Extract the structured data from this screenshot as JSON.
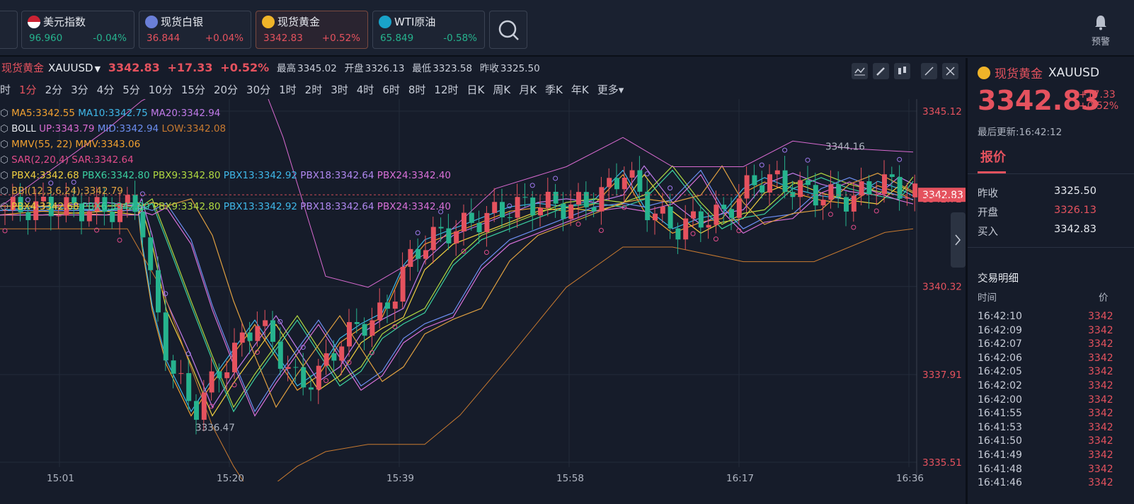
{
  "tickers": [
    {
      "name": "美元指数",
      "price": "96.960",
      "change": "-0.04%",
      "dir": "down",
      "icon": "us-flag-icon"
    },
    {
      "name": "现货白银",
      "price": "36.844",
      "change": "+0.04%",
      "dir": "up",
      "icon": "silver-icon"
    },
    {
      "name": "现货黄金",
      "price": "3342.83",
      "change": "+0.52%",
      "dir": "up",
      "icon": "gold-icon"
    },
    {
      "name": "WTI原油",
      "price": "65.849",
      "change": "-0.58%",
      "dir": "down",
      "icon": "oil-icon"
    }
  ],
  "alert_label": "预警",
  "header": {
    "name": "现货黄金",
    "symbol": "XAUUSD",
    "price": "3342.83",
    "change": "+17.33",
    "pct": "+0.52%",
    "high_label": "最高",
    "high": "3345.02",
    "open_label": "开盘",
    "open": "3326.13",
    "low_label": "最低",
    "low": "3323.58",
    "prev_label": "昨收",
    "prev": "3325.50"
  },
  "periods": [
    "时",
    "1分",
    "2分",
    "3分",
    "4分",
    "5分",
    "10分",
    "15分",
    "20分",
    "30分",
    "1时",
    "2时",
    "3时",
    "4时",
    "6时",
    "8时",
    "12时",
    "日K",
    "周K",
    "月K",
    "季K",
    "年K",
    "更多"
  ],
  "selected_period": "1分",
  "indicators": {
    "ma": [
      {
        "t": "MA5:3342.55",
        "c": "#f0a030"
      },
      {
        "t": "MA10:3342.75",
        "c": "#3fb7e8"
      },
      {
        "t": "MA20:3342.94",
        "c": "#c07ae8"
      }
    ],
    "boll": [
      {
        "t": "BOLL",
        "c": "#e5e8ee"
      },
      {
        "t": "UP:3343.79",
        "c": "#d86ad0"
      },
      {
        "t": "MID:3342.94",
        "c": "#6c8ef0"
      },
      {
        "t": "LOW:3342.08",
        "c": "#c87a30"
      }
    ],
    "mmv": [
      {
        "t": "MMV(55, 22)",
        "c": "#f0a030"
      },
      {
        "t": "MMV:3343.06",
        "c": "#f0a030"
      }
    ],
    "sar": [
      {
        "t": "SAR(2,20,4)",
        "c": "#e04c8a"
      },
      {
        "t": "SAR:3342.64",
        "c": "#e04c8a"
      }
    ],
    "pbx": [
      {
        "t": "PBX4:3342.68",
        "c": "#f0d040"
      },
      {
        "t": "PBX6:3342.80",
        "c": "#3bd0a0"
      },
      {
        "t": "PBX9:3342.80",
        "c": "#b0d840"
      },
      {
        "t": "PBX13:3342.92",
        "c": "#3fb7e8"
      },
      {
        "t": "PBX18:3342.64",
        "c": "#b088f0"
      },
      {
        "t": "PBX24:3342.40",
        "c": "#d870d8"
      }
    ],
    "bbi": [
      {
        "t": "BBI(12,3,6,24):3342.79",
        "c": "#e0a040"
      }
    ],
    "pbx2": [
      {
        "t": "PBX4:3342.68",
        "c": "#f0d040"
      },
      {
        "t": "PBX6:3342.80",
        "c": "#3bd0a0"
      },
      {
        "t": "PBX9:3342.80",
        "c": "#b0d840"
      },
      {
        "t": "PBX13:3342.92",
        "c": "#3fb7e8"
      },
      {
        "t": "PBX18:3342.64",
        "c": "#b088f0"
      },
      {
        "t": "PBX24:3342.40",
        "c": "#d870d8"
      }
    ]
  },
  "y_ticks": [
    "3345.12",
    "3342.72",
    "3340.32",
    "3337.91",
    "3335.51"
  ],
  "current_price_tag": "3342.83",
  "x_ticks": [
    "15:01",
    "15:20",
    "15:39",
    "15:58",
    "16:17",
    "16:36"
  ],
  "annotations": {
    "low": "3336.47",
    "high": "3344.16"
  },
  "right": {
    "name": "现货黄金",
    "symbol": "XAUUSD",
    "price": "3342.83",
    "change": "+17.33",
    "pct": "+0.52%",
    "update_label": "最后更新:16:42:12",
    "tab": "报价",
    "rows": [
      {
        "label": "昨收",
        "value": "3325.50",
        "color": "#e5e8ee"
      },
      {
        "label": "开盘",
        "value": "3326.13",
        "color": "#e5525e"
      },
      {
        "label": "买入",
        "value": "3342.83",
        "color": "#e5e8ee"
      }
    ],
    "trades_title": "交易明细",
    "col_time": "时间",
    "col_price": "价",
    "trades": [
      "16:42:10",
      "16:42:09",
      "16:42:07",
      "16:42:06",
      "16:42:05",
      "16:42:02",
      "16:42:00",
      "16:41:55",
      "16:41:53",
      "16:41:50",
      "16:41:49",
      "16:41:48",
      "16:41:46"
    ],
    "trade_price": "3342"
  }
}
